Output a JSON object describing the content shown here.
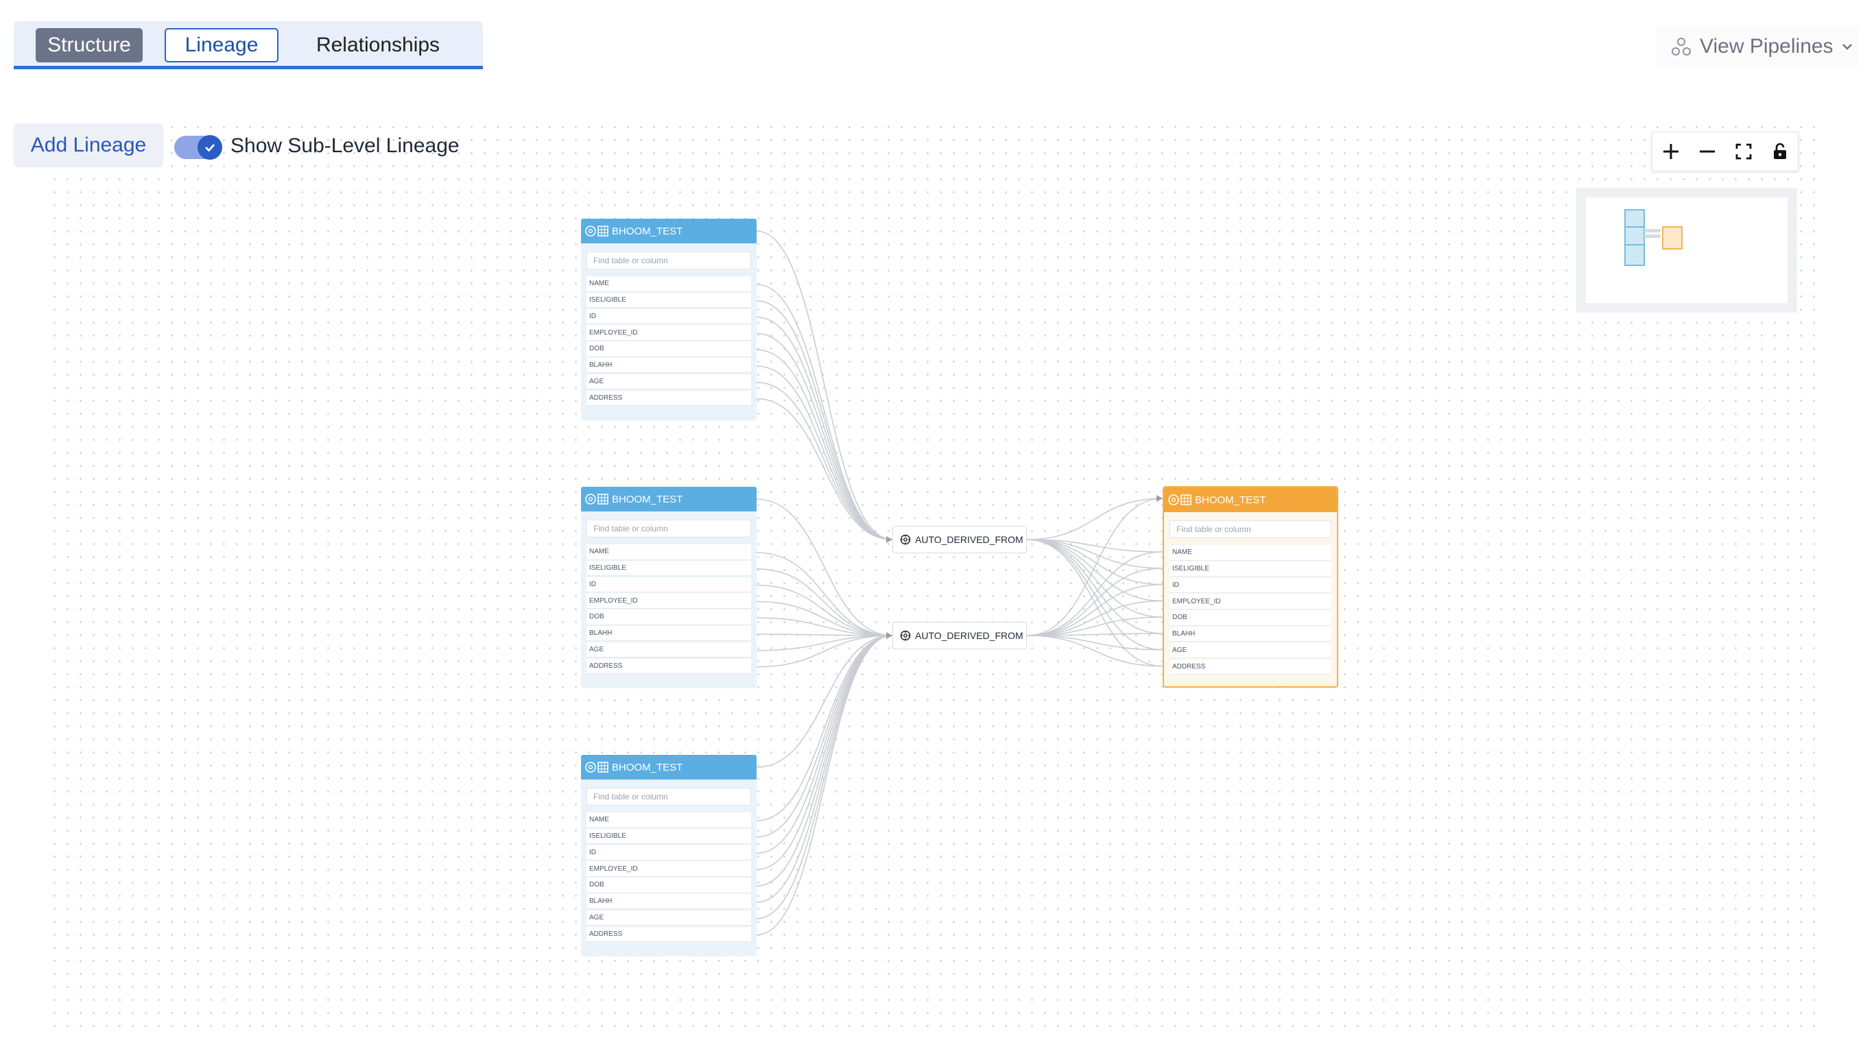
{
  "tabs": [
    {
      "label": "Structure"
    },
    {
      "label": "Lineage"
    },
    {
      "label": "Relationships"
    }
  ],
  "header": {
    "view_pipelines_label": "View Pipelines"
  },
  "toolbar": {
    "add_lineage_label": "Add Lineage",
    "sub_level_toggle": {
      "label": "Show Sub-Level Lineage",
      "checked": true
    }
  },
  "zoom_controls": [
    "plus-icon",
    "minus-icon",
    "fit-view-icon",
    "lock-icon"
  ],
  "colors": {
    "source_header": "#5aaee2",
    "target_header": "#f3a73b",
    "accent": "#2c5cc5"
  },
  "graph": {
    "source_tables": [
      {
        "name": "BHOOM_TEST",
        "search_placeholder": "Find table or column",
        "columns": [
          "NAME",
          "ISELIGIBLE",
          "ID",
          "EMPLOYEE_ID",
          "DOB",
          "BLAHH",
          "AGE",
          "ADDRESS"
        ]
      },
      {
        "name": "BHOOM_TEST",
        "search_placeholder": "Find table or column",
        "columns": [
          "NAME",
          "ISELIGIBLE",
          "ID",
          "EMPLOYEE_ID",
          "DOB",
          "BLAHH",
          "AGE",
          "ADDRESS"
        ]
      },
      {
        "name": "BHOOM_TEST",
        "search_placeholder": "Find table or column",
        "columns": [
          "NAME",
          "ISELIGIBLE",
          "ID",
          "EMPLOYEE_ID",
          "DOB",
          "BLAHH",
          "AGE",
          "ADDRESS"
        ]
      }
    ],
    "processes": [
      {
        "label": "AUTO_DERIVED_FROM"
      },
      {
        "label": "AUTO_DERIVED_FROM"
      }
    ],
    "target_table": {
      "name": "BHOOM_TEST",
      "search_placeholder": "Find table or column",
      "columns": [
        "NAME",
        "ISELIGIBLE",
        "ID",
        "EMPLOYEE_ID",
        "DOB",
        "BLAHH",
        "AGE",
        "ADDRESS"
      ]
    }
  }
}
